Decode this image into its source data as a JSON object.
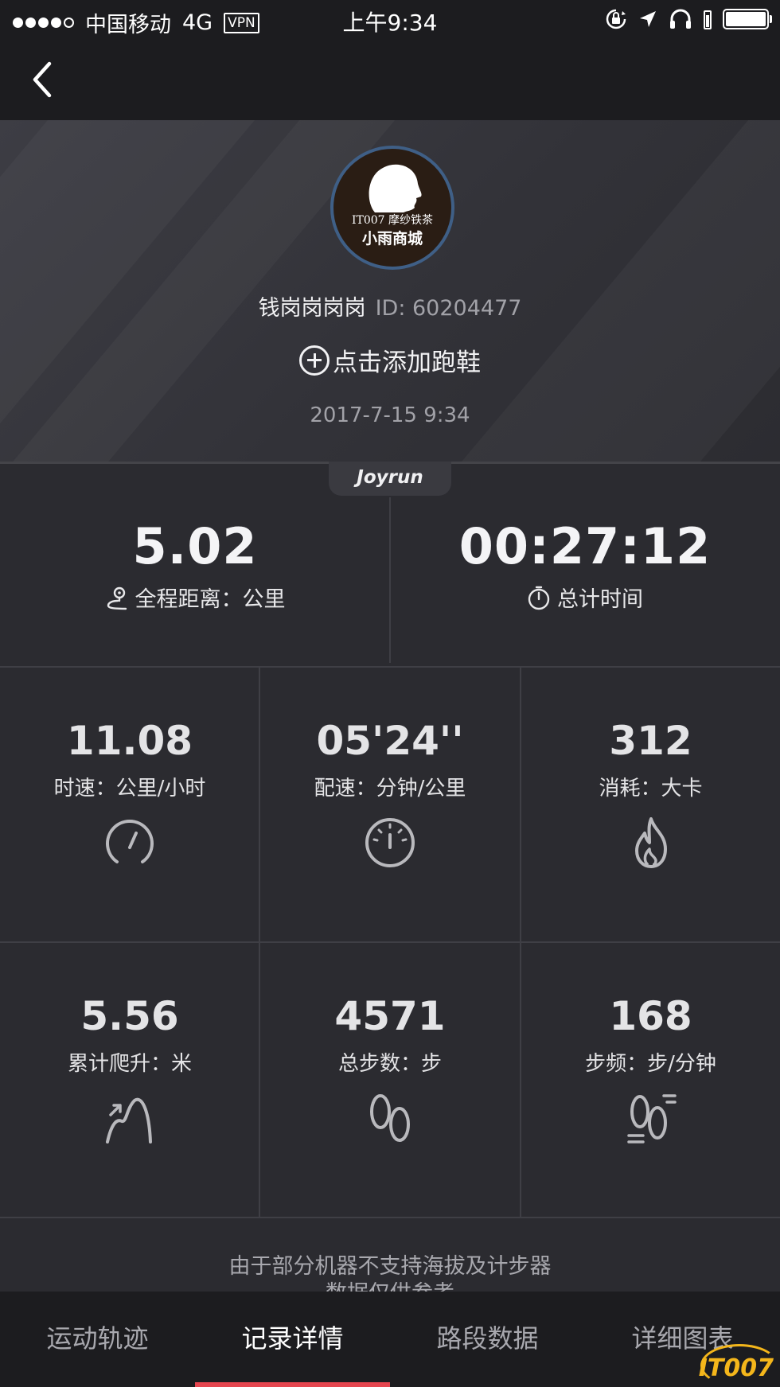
{
  "status_bar": {
    "carrier": "中国移动",
    "network": "4G",
    "vpn": "VPN",
    "time": "上午9:34"
  },
  "profile": {
    "avatar_line1": "IT007 摩纱铁茶",
    "avatar_line2": "小雨商城",
    "username": "钱岗岗岗岗",
    "user_id": "ID: 60204477",
    "add_shoes_label": "点击添加跑鞋",
    "date": "2017-7-15 9:34"
  },
  "brand": "Joyrun",
  "summary": {
    "distance": {
      "value": "5.02",
      "label": "全程距离：公里",
      "icon": "route-pin-icon"
    },
    "duration": {
      "value": "00:27:12",
      "label": "总计时间",
      "icon": "stopwatch-icon"
    }
  },
  "grid": [
    {
      "value": "11.08",
      "label": "时速：公里/小时",
      "icon": "speedometer-icon"
    },
    {
      "value": "05'24''",
      "label": "配速：分钟/公里",
      "icon": "pace-gauge-icon"
    },
    {
      "value": "312",
      "label": "消耗：大卡",
      "icon": "flame-icon"
    },
    {
      "value": "5.56",
      "label": "累计爬升：米",
      "icon": "climb-icon"
    },
    {
      "value": "4571",
      "label": "总步数：步",
      "icon": "footprints-icon"
    },
    {
      "value": "168",
      "label": "步频：步/分钟",
      "icon": "cadence-icon"
    }
  ],
  "disclaimer": {
    "line1": "由于部分机器不支持海拔及计步器",
    "line2": "数据仅供参考"
  },
  "tabs": [
    {
      "label": "运动轨迹"
    },
    {
      "label": "记录详情"
    },
    {
      "label": "路段数据"
    },
    {
      "label": "详细图表"
    }
  ],
  "active_tab": "记录详情",
  "watermark": "IT007",
  "colors": {
    "accent": "#e5464f",
    "background": "#2b2b30",
    "bar": "#1c1c1f",
    "watermark": "#f4b61b"
  }
}
